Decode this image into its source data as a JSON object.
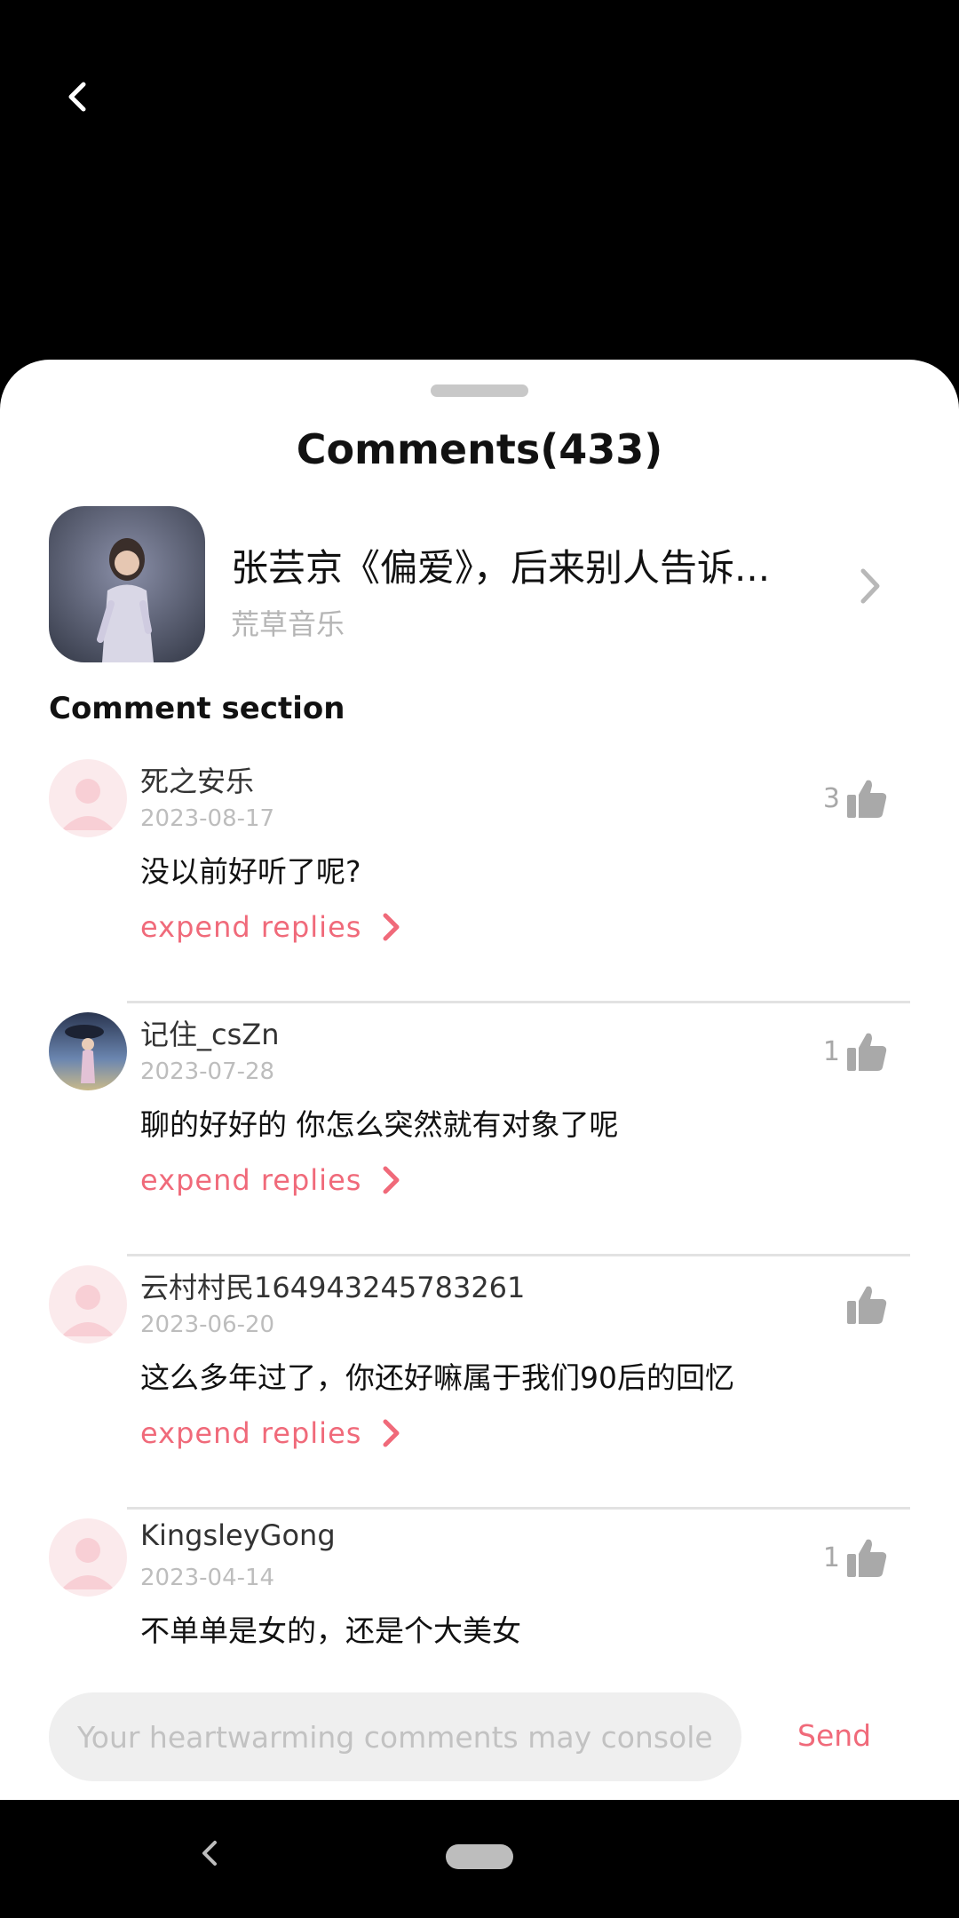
{
  "header": {
    "back_icon": "chevron-left-icon"
  },
  "sheet": {
    "title": "Comments(433)"
  },
  "song": {
    "title": "张芸京《偏爱》，后来别人告诉...",
    "artist": "荒草音乐",
    "chevron_icon": "chevron-right-icon"
  },
  "section_label": "Comment section",
  "comments": [
    {
      "username": "死之安乐",
      "date": "2023-08-17",
      "text": "没以前好听了呢?",
      "likes": "3",
      "expand_label": "expend replies",
      "avatar": "default-avatar"
    },
    {
      "username": "记住_csZn",
      "date": "2023-07-28",
      "text": "聊的好好的 你怎么突然就有对象了呢",
      "likes": "1",
      "expand_label": "expend replies",
      "avatar": "photo-avatar"
    },
    {
      "username": "云村村民164943245783261",
      "date": "2023-06-20",
      "text": "这么多年过了，你还好嘛属于我们90后的回忆",
      "likes": "",
      "expand_label": "expend replies",
      "avatar": "default-avatar"
    },
    {
      "username": "KingsleyGong",
      "date": "2023-04-14",
      "text": "不单单是女的，还是个大美女",
      "likes": "1",
      "avatar": "default-avatar"
    }
  ],
  "composer": {
    "placeholder": "Your heartwarming comments may console ...",
    "send_label": "Send"
  },
  "colors": {
    "accent": "#f06a7a",
    "muted": "#bdbdbd",
    "sheet_bg": "#ffffff",
    "screen_bg": "#000000"
  }
}
